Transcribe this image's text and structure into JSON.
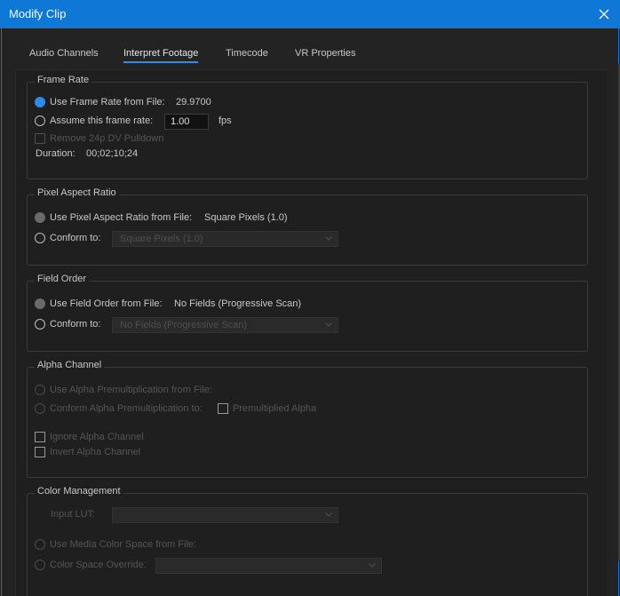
{
  "window": {
    "title": "Modify Clip"
  },
  "tabs": [
    {
      "label": "Audio Channels"
    },
    {
      "label": "Interpret Footage"
    },
    {
      "label": "Timecode"
    },
    {
      "label": "VR Properties"
    }
  ],
  "frame_rate": {
    "legend": "Frame Rate",
    "use_from_file_label": "Use Frame Rate from File:",
    "file_value": "29.9700",
    "assume_label": "Assume this frame rate:",
    "assume_value": "1.00",
    "fps_label": "fps",
    "remove_pulldown_label": "Remove 24p DV Pulldown",
    "duration_label": "Duration:",
    "duration_value": "00;02;10;24"
  },
  "pixel_aspect": {
    "legend": "Pixel Aspect Ratio",
    "use_from_file_label": "Use Pixel Aspect Ratio from File:",
    "file_value": "Square Pixels (1.0)",
    "conform_label": "Conform to:",
    "conform_value": "Square Pixels (1.0)"
  },
  "field_order": {
    "legend": "Field Order",
    "use_from_file_label": "Use Field Order from File:",
    "file_value": "No Fields (Progressive Scan)",
    "conform_label": "Conform to:",
    "conform_value": "No Fields (Progressive Scan)"
  },
  "alpha_channel": {
    "legend": "Alpha Channel",
    "use_premult_label": "Use Alpha Premultiplication from File:",
    "conform_premult_label": "Conform Alpha Premultiplication to:",
    "premultiplied_label": "Premultiplied Alpha",
    "ignore_label": "Ignore Alpha Channel",
    "invert_label": "Invert Alpha Channel"
  },
  "color_management": {
    "legend": "Color Management",
    "input_lut_label": "Input LUT:",
    "input_lut_value": "",
    "use_media_label": "Use Media Color Space from File:",
    "override_label": "Color Space Override:",
    "override_value": ""
  },
  "colors": {
    "accent": "#2d8ceb",
    "titlebar": "#0f78d6"
  }
}
